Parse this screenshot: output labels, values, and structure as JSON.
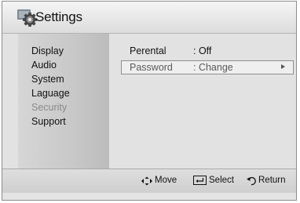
{
  "window": {
    "title": "Settings"
  },
  "icons": {
    "title": "gear-icon",
    "move": "move-arrows-icon",
    "select": "enter-key-icon",
    "return": "return-arrow-icon"
  },
  "sidebar": {
    "items": [
      {
        "label": "Display",
        "enabled": true
      },
      {
        "label": "Audio",
        "enabled": true
      },
      {
        "label": "System",
        "enabled": true
      },
      {
        "label": "Laguage",
        "enabled": true
      },
      {
        "label": "Security",
        "enabled": false
      },
      {
        "label": "Support",
        "enabled": true
      }
    ]
  },
  "main": {
    "rows": [
      {
        "label": "Perental",
        "value": ": Off"
      },
      {
        "label": "Password",
        "value": ": Change",
        "selected": true
      }
    ]
  },
  "footer": {
    "move_label": "Move",
    "select_label": "Select",
    "return_label": "Return"
  }
}
